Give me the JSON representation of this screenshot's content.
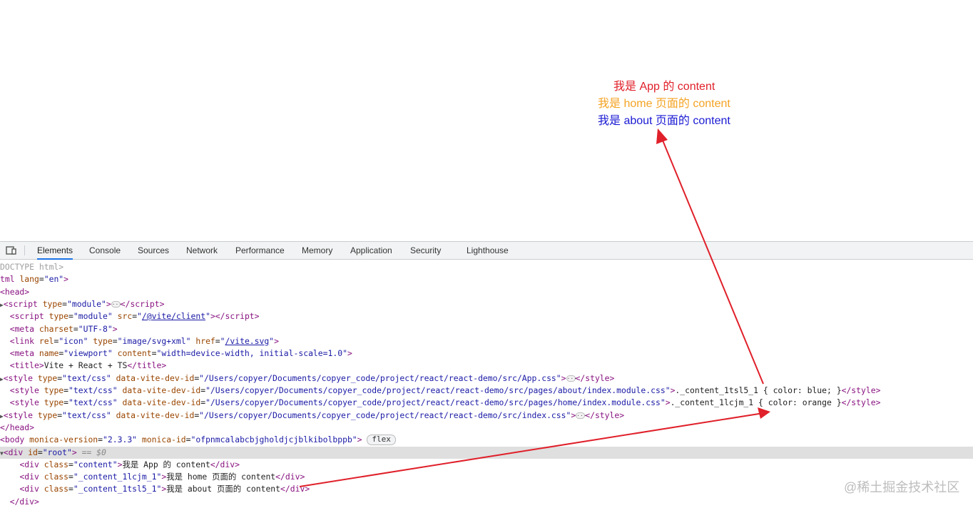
{
  "rendered_page": {
    "lines": [
      {
        "text": "我是 App 的 content",
        "color": "#e0202a"
      },
      {
        "text": "我是 home 页面的 content",
        "color": "#f4a324"
      },
      {
        "text": "我是 about 页面的 content",
        "color": "#1a1ad4"
      }
    ]
  },
  "devtools": {
    "device_icon": "device-toggle-icon",
    "tabs": [
      {
        "label": "Elements",
        "active": true
      },
      {
        "label": "Console",
        "active": false
      },
      {
        "label": "Sources",
        "active": false
      },
      {
        "label": "Network",
        "active": false
      },
      {
        "label": "Performance",
        "active": false
      },
      {
        "label": "Memory",
        "active": false
      },
      {
        "label": "Application",
        "active": false
      },
      {
        "label": "Security",
        "active": false
      },
      {
        "label": "Lighthouse",
        "active": false
      }
    ],
    "dom": {
      "doctype": "DOCTYPE html>",
      "html_open": {
        "tag": "tml",
        "attr": "lang",
        "value": "\"en\""
      },
      "head_open": "<head>",
      "script1": {
        "type_value": "\"module\""
      },
      "script2": {
        "type_value": "\"module\"",
        "src_value": "/@vite/client"
      },
      "meta1": {
        "charset_value": "\"UTF-8\""
      },
      "link1": {
        "rel_value": "\"icon\"",
        "type_value": "\"image/svg+xml\"",
        "href_value": "/vite.svg"
      },
      "meta2": {
        "name_value": "\"viewport\"",
        "content_value": "\"width=device-width, initial-scale=1.0\""
      },
      "title": {
        "text": "Vite + React + TS"
      },
      "style1": {
        "type_value": "\"text/css\"",
        "id_value": "\"/Users/copyer/Documents/copyer_code/project/react/react-demo/src/App.css\""
      },
      "style2": {
        "type_value": "\"text/css\"",
        "id_value": "\"/Users/copyer/Documents/copyer_code/project/react/react-demo/src/pages/about/index.module.css\"",
        "css": "._content_1tsl5_1 { color: blue; }"
      },
      "style3": {
        "type_value": "\"text/css\"",
        "id_value": "\"/Users/copyer/Documents/copyer_code/project/react/react-demo/src/pages/home/index.module.css\"",
        "css": "._content_1lcjm_1 { color: orange }"
      },
      "style4": {
        "type_value": "\"text/css\"",
        "id_value": "\"/Users/copyer/Documents/copyer_code/project/react/react-demo/src/index.css\""
      },
      "head_close": "</head>",
      "body": {
        "version_value": "\"2.3.3\"",
        "id_value": "\"ofpnmcalabcbjgholdjcjblkibolbppb\"",
        "badge": "flex"
      },
      "root": {
        "id_value": "\"root\"",
        "ref": "== $0"
      },
      "div1": {
        "class_value": "\"content\"",
        "text": "我是 App 的 content"
      },
      "div2": {
        "class_value": "\"_content_1lcjm_1\"",
        "text": "我是 home 页面的 content"
      },
      "div3": {
        "class_value": "\"_content_1tsl5_1\"",
        "text": "我是 about 页面的 content"
      },
      "div_close": "</div>"
    }
  },
  "annotation": {
    "arrow_color": "#e0202a"
  },
  "watermark": "@稀土掘金技术社区"
}
